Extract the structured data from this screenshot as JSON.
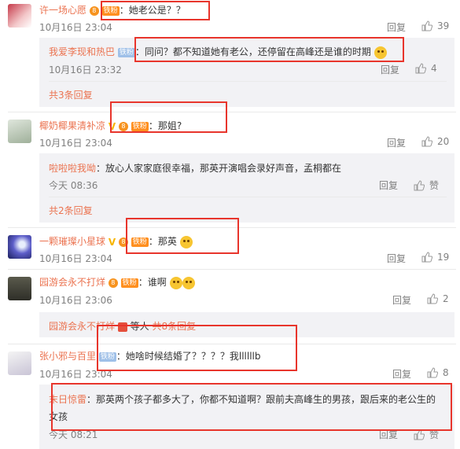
{
  "comments": [
    {
      "user": "许一场心愿",
      "text": "她老公是？？",
      "time": "10月16日 23:04",
      "reply": "回复",
      "likes": "39",
      "replies": [
        {
          "user": "我爱李现和热巴",
          "text": "同问？都不知道她有老公，还停留在高峰还是谁的时期",
          "time": "10月16日 23:32",
          "reply": "回复",
          "likes": "4"
        }
      ],
      "more": "共3条回复"
    },
    {
      "user": "椰奶椰果清补凉",
      "text": "那姐?",
      "time": "10月16日 23:04",
      "reply": "回复",
      "likes": "20",
      "replies": [
        {
          "user": "啦啦啦我呦",
          "text": "放心人家家庭很幸福，那英开演唱会录好声音，孟桐都在",
          "time": "今天 08:36",
          "reply": "回复",
          "likes": "赞"
        }
      ],
      "more": "共2条回复"
    },
    {
      "user": "一颗璀璨小星球",
      "text": "那英",
      "time": "10月16日 23:04",
      "reply": "回复",
      "likes": "19"
    },
    {
      "user": "园游会永不打烊",
      "text": "谁啊",
      "time": "10月16日 23:06",
      "reply": "回复",
      "likes": "2",
      "more_user": "园游会永不打烊",
      "more_mid": "等人",
      "more": "共8条回复"
    },
    {
      "user": "张小邪与百里",
      "text": "她啥时候结婚了？？？？我llllllb",
      "time": "10月16日 23:04",
      "reply": "回复",
      "likes": "8",
      "replies": [
        {
          "user": "末日惊雷",
          "text": "那英两个孩子都多大了，你都不知道啊？跟前夫高峰生的男孩，跟后来的老公生的",
          "text2": "女孩",
          "time": "今天 08:21",
          "reply": "回复",
          "likes": "赞"
        }
      ]
    }
  ],
  "badges": {
    "fan": "铁粉",
    "vip": "8"
  }
}
